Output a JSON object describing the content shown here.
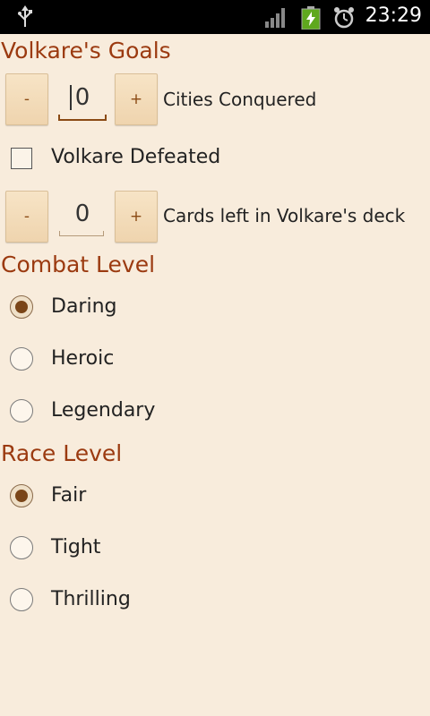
{
  "status_bar": {
    "time": "23:29",
    "icons": [
      "usb-icon",
      "signal-icon",
      "battery-charging-icon",
      "alarm-icon"
    ]
  },
  "goals": {
    "title": "Volkare's Goals",
    "cities": {
      "minus": "-",
      "value": "0",
      "plus": "+",
      "label": "Cities Conquered"
    },
    "defeated": {
      "label": "Volkare Defeated",
      "checked": false
    },
    "cards": {
      "minus": "-",
      "value": "0",
      "plus": "+",
      "label": "Cards left in Volkare's deck"
    }
  },
  "combat_level": {
    "title": "Combat Level",
    "options": [
      {
        "label": "Daring",
        "checked": true
      },
      {
        "label": "Heroic",
        "checked": false
      },
      {
        "label": "Legendary",
        "checked": false
      }
    ]
  },
  "race_level": {
    "title": "Race Level",
    "options": [
      {
        "label": "Fair",
        "checked": true
      },
      {
        "label": "Tight",
        "checked": false
      },
      {
        "label": "Thrilling",
        "checked": false
      }
    ]
  },
  "colors": {
    "background": "#f8ecdc",
    "section_title": "#9b3a10",
    "radio_fill": "#7a4518"
  }
}
